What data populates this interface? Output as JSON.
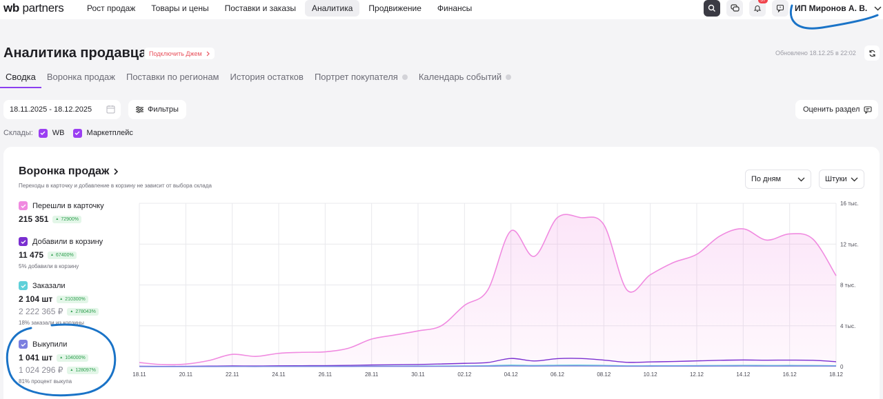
{
  "nav": {
    "logo_wb": "wb",
    "logo_partners": "partners",
    "items": [
      "Рост продаж",
      "Товары и цены",
      "Поставки и заказы",
      "Аналитика",
      "Продвижение",
      "Финансы"
    ],
    "active_item": "Аналитика",
    "notification_count": "57",
    "user_name": "ИП Миронов А. В."
  },
  "header": {
    "title": "Аналитика продавца",
    "jem_link": "Подключить Джем",
    "updated": "Обновлено 18.12.25 в 22:02"
  },
  "tabs": [
    {
      "label": "Сводка",
      "active": true,
      "dot": false
    },
    {
      "label": "Воронка продаж",
      "active": false,
      "dot": false
    },
    {
      "label": "Поставки по регионам",
      "active": false,
      "dot": false
    },
    {
      "label": "История остатков",
      "active": false,
      "dot": false
    },
    {
      "label": "Портрет покупателя",
      "active": false,
      "dot": true
    },
    {
      "label": "Календарь событий",
      "active": false,
      "dot": true
    }
  ],
  "controls": {
    "date_range": "18.11.2025 - 18.12.2025",
    "filters_label": "Фильтры",
    "rate_label": "Оценить раздел",
    "warehouses_label": "Склады:",
    "warehouses": [
      "WB",
      "Маркетплейс"
    ]
  },
  "funnel": {
    "title": "Воронка продаж",
    "subtitle": "Переходы в карточку и добавление в корзину не зависит от выбора склада",
    "period_select": "По дням",
    "unit_select": "Штуки",
    "metrics": [
      {
        "label": "Перешли в карточку",
        "value": "215 351",
        "change": "72900%",
        "color": "#f08ae0"
      },
      {
        "label": "Добавили в корзину",
        "value": "11 475",
        "change": "67400%",
        "note": "5% добавили в корзину",
        "color": "#7a2fd0"
      },
      {
        "label": "Заказали",
        "value": "2 104 шт",
        "change": "210300%",
        "value2": "2 222 365 ₽",
        "change2": "278043%",
        "note": "18% заказали из корзины",
        "color": "#5fd0d9"
      },
      {
        "label": "Выкупили",
        "value": "1 041 шт",
        "change": "104000%",
        "value2": "1 024 296 ₽",
        "change2": "128097%",
        "note": "81% процент выкупа",
        "color": "#7b7fe0"
      }
    ]
  },
  "colors": {
    "accent": "#9b3ff2",
    "card_views": "#f08ae0",
    "cart": "#7a2fd0",
    "orders": "#5fd0d9",
    "buyouts": "#7b7fe0",
    "annotation": "#1a73c7"
  },
  "chart_data": {
    "type": "area",
    "x": [
      "18.11",
      "19.11",
      "20.11",
      "21.11",
      "22.11",
      "23.11",
      "24.11",
      "25.11",
      "26.11",
      "27.11",
      "28.11",
      "29.11",
      "30.11",
      "01.12",
      "02.12",
      "03.12",
      "04.12",
      "05.12",
      "06.12",
      "07.12",
      "08.12",
      "09.12",
      "10.12",
      "11.12",
      "12.12",
      "13.12",
      "14.12",
      "15.12",
      "16.12",
      "17.12",
      "18.12"
    ],
    "x_tick_labels": [
      "18.11",
      "20.11",
      "22.11",
      "24.11",
      "26.11",
      "28.11",
      "30.11",
      "02.12",
      "04.12",
      "06.12",
      "08.12",
      "10.12",
      "12.12",
      "14.12",
      "16.12",
      "18.12"
    ],
    "ylim": [
      0,
      16000
    ],
    "y_tick_labels": [
      "0",
      "4 тыс.",
      "8 тыс.",
      "12 тыс.",
      "16 тыс."
    ],
    "y_ticks": [
      0,
      4000,
      8000,
      12000,
      16000
    ],
    "grid": true,
    "series": [
      {
        "name": "Перешли в карточку",
        "color": "#f08ae0",
        "fill": true,
        "values": [
          400,
          200,
          250,
          600,
          1200,
          1000,
          1300,
          1400,
          1450,
          1800,
          2700,
          3100,
          3500,
          4000,
          6000,
          7500,
          13300,
          10800,
          14600,
          14600,
          13900,
          7500,
          9000,
          10200,
          11000,
          12800,
          13500,
          12400,
          13000,
          12500,
          8900
        ]
      },
      {
        "name": "Добавили в корзину",
        "color": "#7a2fd0",
        "fill": false,
        "values": [
          40,
          20,
          30,
          50,
          70,
          60,
          80,
          90,
          100,
          120,
          160,
          180,
          210,
          260,
          320,
          400,
          800,
          550,
          780,
          800,
          640,
          420,
          460,
          500,
          560,
          620,
          650,
          630,
          640,
          620,
          480
        ]
      },
      {
        "name": "Заказали",
        "color": "#5fd0d9",
        "fill": false,
        "values": [
          10,
          5,
          6,
          12,
          20,
          18,
          22,
          25,
          28,
          32,
          40,
          46,
          52,
          60,
          70,
          90,
          150,
          110,
          140,
          150,
          120,
          80,
          85,
          90,
          100,
          110,
          120,
          115,
          118,
          112,
          90
        ]
      },
      {
        "name": "Выкупили",
        "color": "#7b7fe0",
        "fill": false,
        "values": [
          5,
          3,
          3,
          6,
          10,
          9,
          11,
          12,
          14,
          16,
          20,
          23,
          26,
          30,
          35,
          45,
          75,
          55,
          70,
          75,
          60,
          40,
          42,
          45,
          50,
          55,
          60,
          57,
          59,
          56,
          45
        ]
      }
    ]
  }
}
